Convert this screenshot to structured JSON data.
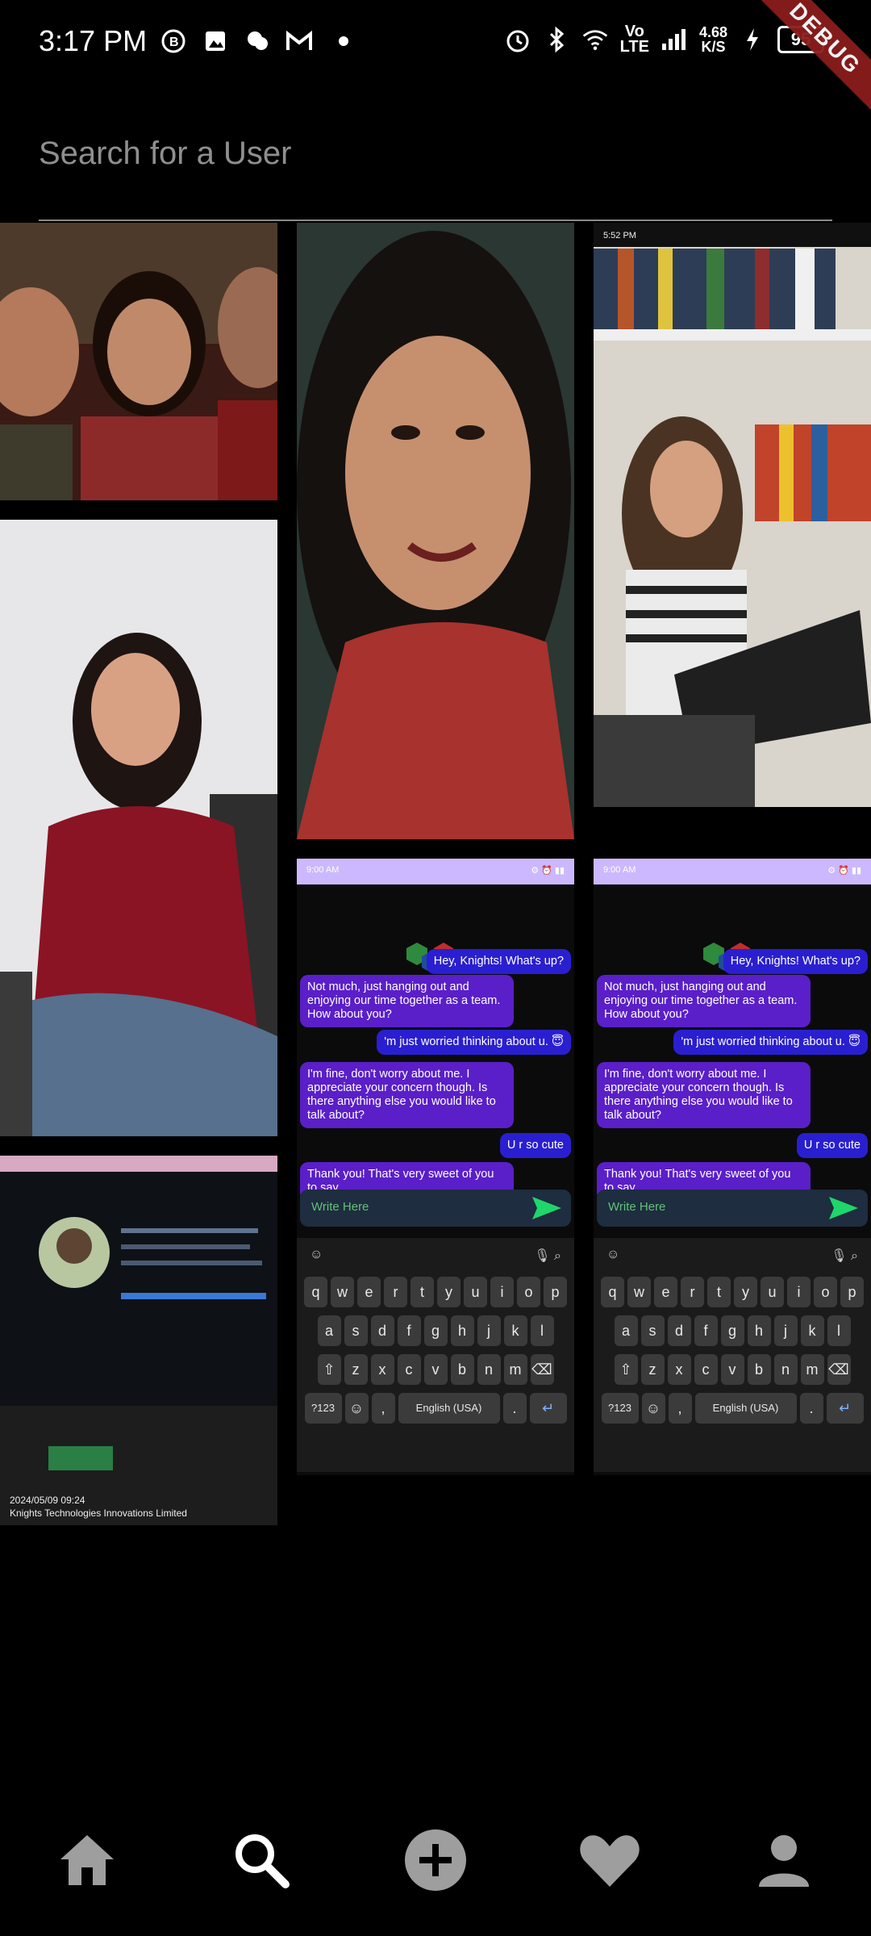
{
  "status_bar": {
    "time": "3:17 PM",
    "net_speed_value": "4.68",
    "net_speed_unit": "K/S",
    "volte": "Vo\nLTE",
    "battery": "95",
    "debug_label": "DEBUG"
  },
  "search": {
    "placeholder": "Search for a User"
  },
  "tiles": {
    "laptop_photo": {
      "timestamp": "2024/05/09 09:24",
      "company": "Knights Technologies Innovations Limited"
    },
    "book_photo": {
      "status_time": "5:52 PM"
    },
    "chat_screens": [
      {
        "status_time": "9:00 AM",
        "messages": [
          {
            "side": "right",
            "text": "Hey, Knights! What's up?"
          },
          {
            "side": "left",
            "text": "Not much, just hanging out and enjoying our time together as a team. How about you?"
          },
          {
            "side": "right",
            "text": "'m just worried thinking about u. 😇"
          },
          {
            "side": "left",
            "text": "I'm fine, don't worry about me. I appreciate your concern though. Is there anything else you would like to talk about?"
          },
          {
            "side": "right",
            "text": "U r so cute"
          },
          {
            "side": "left",
            "text": "Thank you! That's very sweet of you to say."
          }
        ],
        "input_placeholder": "Write Here",
        "keyboard_language": "English (USA)"
      },
      {
        "status_time": "9:00 AM",
        "messages": [
          {
            "side": "right",
            "text": "Hey, Knights! What's up?"
          },
          {
            "side": "left",
            "text": "Not much, just hanging out and enjoying our time together as a team. How about you?"
          },
          {
            "side": "right",
            "text": "'m just worried thinking about u. 😇"
          },
          {
            "side": "left",
            "text": "I'm fine, don't worry about me. I appreciate your concern though. Is there anything else you would like to talk about?"
          },
          {
            "side": "right",
            "text": "U r so cute"
          },
          {
            "side": "left",
            "text": "Thank you! That's very sweet of you to say."
          }
        ],
        "input_placeholder": "Write Here",
        "keyboard_language": "English (USA)"
      }
    ]
  },
  "keyboard": {
    "row1": [
      "q",
      "w",
      "e",
      "r",
      "t",
      "y",
      "u",
      "i",
      "o",
      "p"
    ],
    "row2": [
      "a",
      "s",
      "d",
      "f",
      "g",
      "h",
      "j",
      "k",
      "l"
    ],
    "row3": [
      "z",
      "x",
      "c",
      "v",
      "b",
      "n",
      "m"
    ],
    "mode_key": "?123",
    "comma": ",",
    "period": "."
  },
  "nav": {
    "items": [
      "home-icon",
      "search-icon",
      "add-circle-icon",
      "heart-icon",
      "person-icon"
    ],
    "icon_color": "#9e9e9e",
    "active_color": "#ffffff"
  }
}
